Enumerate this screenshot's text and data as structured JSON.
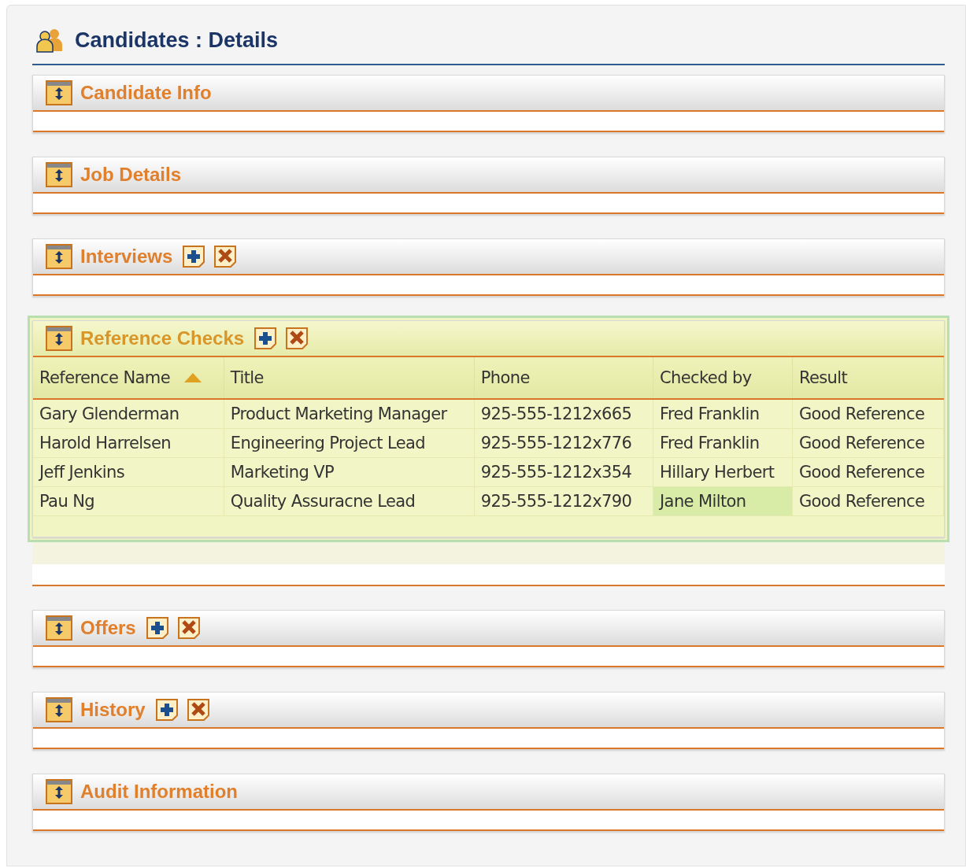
{
  "page_title": "Candidates : Details",
  "sections": [
    {
      "title": "Candidate Info",
      "actions": false,
      "highlighted": false
    },
    {
      "title": "Job Details",
      "actions": false,
      "highlighted": false
    },
    {
      "title": "Interviews",
      "actions": true,
      "highlighted": false
    },
    {
      "title": "Reference Checks",
      "actions": true,
      "highlighted": true,
      "table": {
        "columns": [
          {
            "label": "Reference Name",
            "sorted": true
          },
          {
            "label": "Title",
            "sorted": false
          },
          {
            "label": "Phone",
            "sorted": false
          },
          {
            "label": "Checked by",
            "sorted": false
          },
          {
            "label": "Result",
            "sorted": false
          }
        ],
        "rows": [
          {
            "cells": [
              {
                "text": "Gary Glenderman",
                "selected": false
              },
              {
                "text": "Product Marketing Manager",
                "selected": false
              },
              {
                "text": "925-555-1212x665",
                "selected": false
              },
              {
                "text": "Fred Franklin",
                "selected": false
              },
              {
                "text": "Good Reference",
                "selected": false
              }
            ]
          },
          {
            "cells": [
              {
                "text": "Harold Harrelsen",
                "selected": false
              },
              {
                "text": "Engineering Project Lead",
                "selected": false
              },
              {
                "text": "925-555-1212x776",
                "selected": false
              },
              {
                "text": "Fred Franklin",
                "selected": false
              },
              {
                "text": "Good Reference",
                "selected": false
              }
            ]
          },
          {
            "cells": [
              {
                "text": "Jeff Jenkins",
                "selected": false
              },
              {
                "text": "Marketing VP",
                "selected": false
              },
              {
                "text": "925-555-1212x354",
                "selected": false
              },
              {
                "text": "Hillary Herbert",
                "selected": false
              },
              {
                "text": "Good Reference",
                "selected": false
              }
            ]
          },
          {
            "cells": [
              {
                "text": "Pau Ng",
                "selected": false
              },
              {
                "text": "Quality Assuracne Lead",
                "selected": false
              },
              {
                "text": "925-555-1212x790",
                "selected": false
              },
              {
                "text": "Jane Milton",
                "selected": true
              },
              {
                "text": "Good Reference",
                "selected": false
              }
            ]
          }
        ]
      }
    },
    {
      "title": "Offers",
      "actions": true,
      "highlighted": false
    },
    {
      "title": "History",
      "actions": true,
      "highlighted": false
    },
    {
      "title": "Audit Information",
      "actions": false,
      "highlighted": false
    }
  ]
}
